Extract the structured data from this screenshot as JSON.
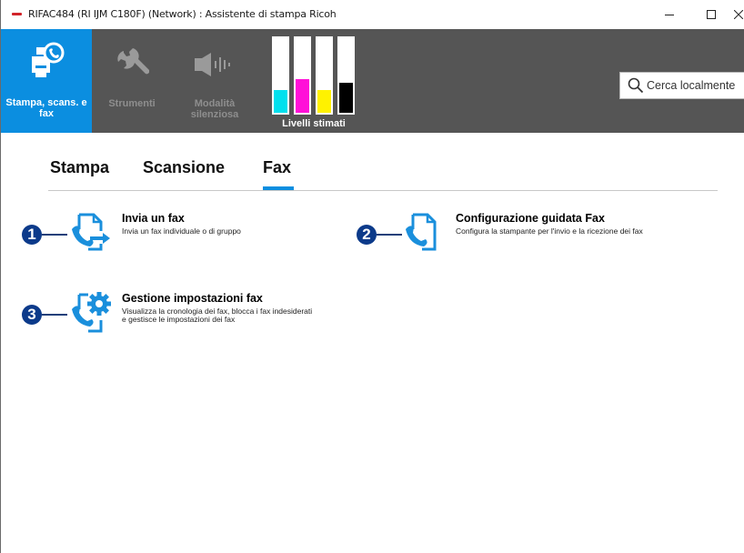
{
  "window": {
    "title": "RIFAC484 (RI IJM C180F) (Network) : Assistente di stampa Ricoh",
    "controls": {
      "minimize": "–",
      "maximize": "☐",
      "close": "×"
    }
  },
  "ribbon": {
    "items": [
      {
        "label": "Stampa, scans. e fax",
        "icon": "print-scan-fax-icon",
        "active": true
      },
      {
        "label": "Strumenti",
        "icon": "wrench-icon",
        "active": false
      },
      {
        "label": "Modalità silenziosa",
        "icon": "speaker-quiet-icon",
        "active": false
      }
    ],
    "ink": {
      "label": "Livelli stimati",
      "tanks": [
        {
          "color_name": "cyan",
          "color": "#00e0ee",
          "level": 0.3
        },
        {
          "color_name": "magenta",
          "color": "#ff10d8",
          "level": 0.45
        },
        {
          "color_name": "yellow",
          "color": "#fff200",
          "level": 0.3
        },
        {
          "color_name": "black",
          "color": "#000000",
          "level": 0.4
        }
      ]
    },
    "search": {
      "placeholder": "Cerca localmente",
      "icon": "search-icon"
    }
  },
  "tabs": [
    {
      "label": "Stampa",
      "selected": false
    },
    {
      "label": "Scansione",
      "selected": false
    },
    {
      "label": "Fax",
      "selected": true
    }
  ],
  "actions": [
    {
      "number": "1",
      "title": "Invia un fax",
      "description": "Invia un fax individuale o di gruppo",
      "icon": "send-fax-icon"
    },
    {
      "number": "2",
      "title": "Configurazione guidata Fax",
      "description": "Configura la stampante per l'invio e la ricezione dei fax",
      "icon": "fax-setup-icon"
    },
    {
      "number": "3",
      "title": "Gestione impostazioni fax",
      "description_lines": [
        "Visualizza la cronologia dei fax, blocca i fax indesiderati",
        "e gestisce le impostazioni dei fax"
      ],
      "icon": "fax-settings-gear-icon"
    }
  ],
  "colors": {
    "accent": "#0b8ee0",
    "ribbon": "#555555",
    "badge": "#0c3a8a",
    "icon_blue": "#1a8fdc"
  }
}
